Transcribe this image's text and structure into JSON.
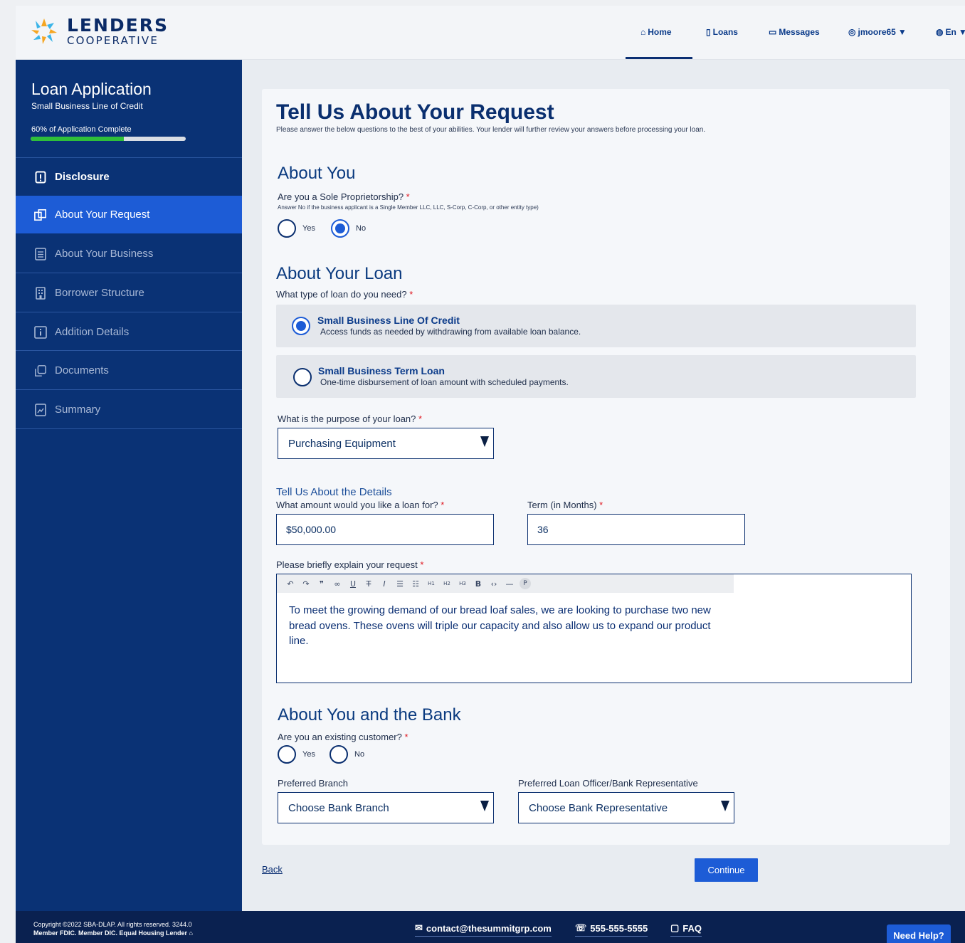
{
  "brand": {
    "name": "LENDERS",
    "tagline": "COOPERATIVE"
  },
  "nav": {
    "home": "Home",
    "loans": "Loans",
    "messages": "Messages",
    "user": "jmoore65",
    "language": "En"
  },
  "sidebar": {
    "title": "Loan Application",
    "subtitle": "Small Business Line of Credit",
    "progress_label": "60% of Application Complete",
    "progress": 0.6,
    "items": [
      {
        "label": "Disclosure",
        "state": "done",
        "icon": "document-alert-icon"
      },
      {
        "label": "About Your Request",
        "state": "active",
        "icon": "copy-icon"
      },
      {
        "label": "About Your Business",
        "state": "pending",
        "icon": "list-icon"
      },
      {
        "label": "Borrower Structure",
        "state": "pending",
        "icon": "building-icon"
      },
      {
        "label": "Addition Details",
        "state": "pending",
        "icon": "info-icon"
      },
      {
        "label": "Documents",
        "state": "pending",
        "icon": "documents-icon"
      },
      {
        "label": "Summary",
        "state": "pending",
        "icon": "summary-icon"
      }
    ]
  },
  "form": {
    "title": "Tell Us About Your Request",
    "subtitle": "Please answer the below questions to the best of your abilities. Your lender will further review your answers before processing your loan.",
    "about_you": {
      "heading": "About You",
      "question": "Are you a Sole Proprietorship?",
      "hint": "Answer No if the business applicant is a Single Member LLC, LLC, S-Corp, C-Corp, or other entity type)",
      "yes": "Yes",
      "no": "No",
      "selected": "No"
    },
    "about_loan": {
      "heading": "About Your Loan",
      "type_question": "What type of loan do you need?",
      "options": [
        {
          "title": "Small Business Line Of Credit",
          "desc": "Access funds as needed by withdrawing from available loan balance.",
          "selected": true
        },
        {
          "title": "Small Business Term Loan",
          "desc": "One-time disbursement of loan amount with scheduled payments.",
          "selected": false
        }
      ],
      "purpose_question": "What is the purpose of your loan?",
      "purpose_value": "Purchasing Equipment"
    },
    "details": {
      "heading": "Tell Us About the Details",
      "amount_label": "What amount would you like a loan for?",
      "amount_value": "$50,000.00",
      "term_label": "Term (in Months)",
      "term_value": "36",
      "explain_label": "Please briefly explain your request",
      "explain_value": "To meet the growing demand of our bread loaf sales, we are looking to purchase two new bread ovens. These ovens will triple our capacity and also allow us to expand  our product line.",
      "toolbar": [
        "undo-icon",
        "redo-icon",
        "quote-icon",
        "link-icon",
        "underline-icon",
        "strikethrough-icon",
        "italic-icon",
        "bullet-list-icon",
        "numbered-list-icon",
        "h1-icon",
        "h2-icon",
        "h3-icon",
        "bold-icon",
        "code-icon",
        "horizontal-rule-icon",
        "paragraph-icon"
      ]
    },
    "bank": {
      "heading": "About You and the Bank",
      "question": "Are you an existing customer?",
      "yes": "Yes",
      "no": "No",
      "branch_label": "Preferred Branch",
      "branch_value": "Choose Bank Branch",
      "rep_label": "Preferred Loan Officer/Bank Representative",
      "rep_value": "Choose Bank Representative"
    },
    "back": "Back",
    "continue": "Continue"
  },
  "footer": {
    "copyright": "Copyright ©2022 SBA-DLAP. All rights reserved. 3244.0",
    "member": "Member FDIC. Member DIC.  Equal Housing Lender",
    "email": "contact@thesummitgrp.com",
    "phone": "555-555-5555",
    "faq": "FAQ",
    "help": "Need Help?"
  },
  "colors": {
    "primary": "#0a3275",
    "accent": "#1d5cd6",
    "progress": "#2fbf3a",
    "required": "#e01b24"
  }
}
